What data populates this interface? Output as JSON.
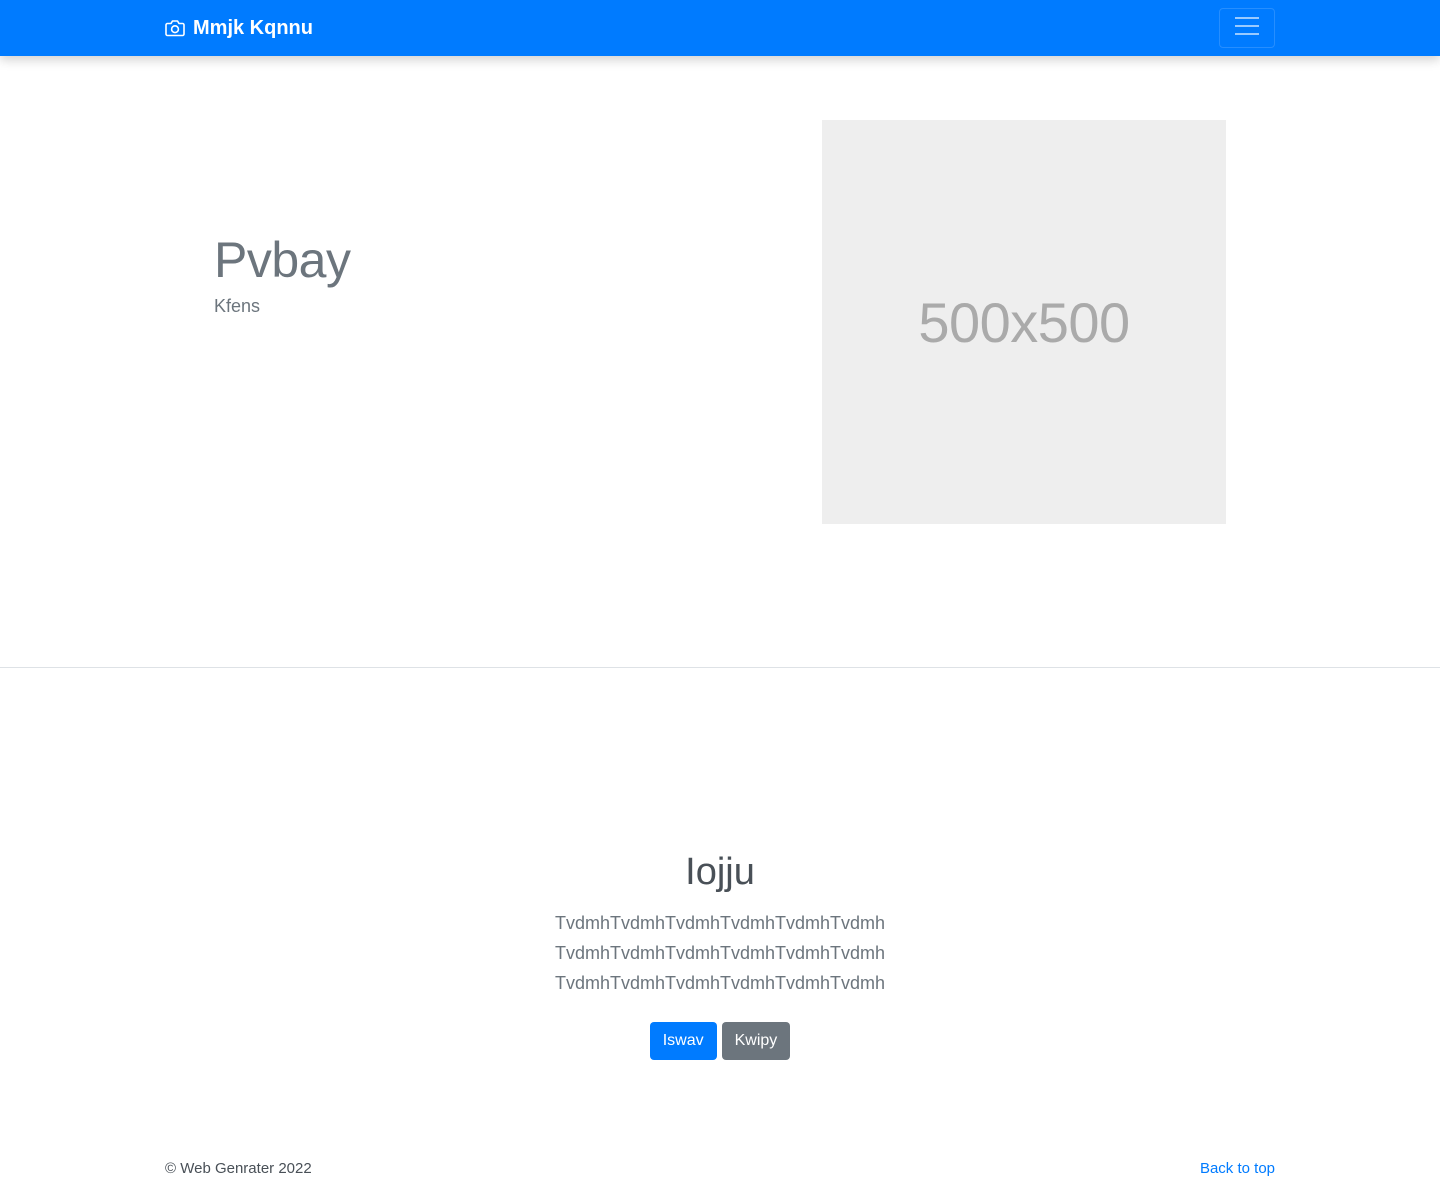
{
  "navbar": {
    "brand": "Mmjk Kqnnu",
    "brand_icon": "camera-icon",
    "toggler_icon": "hamburger-menu-icon",
    "background": "#007bff"
  },
  "hero": {
    "title": "Pvbay",
    "subtitle": "Kfens",
    "image_placeholder_text": "500x500"
  },
  "section": {
    "title": "Iojju",
    "body": "TvdmhTvdmhTvdmhTvdmhTvdmhTvdmhTvdmhTvdmhTvdmhTvdmhTvdmhTvdmhTvdmhTvdmhTvdmhTvdmhTvdmhTvdmh",
    "primary_button": "Iswav",
    "secondary_button": "Kwipy"
  },
  "footer": {
    "copyright": "© Web Genrater 2022",
    "back_to_top": "Back to top"
  }
}
